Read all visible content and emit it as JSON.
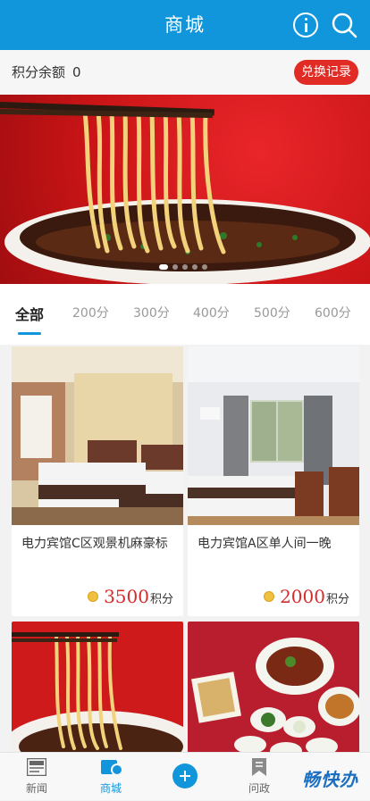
{
  "header": {
    "title": "商城",
    "info_icon": "info-icon",
    "search_icon": "search-icon"
  },
  "points": {
    "label": "积分余额",
    "value": "0",
    "exchange_label": "兑换记录"
  },
  "banner": {
    "icon": "noodle-bowl-image",
    "dots": 5,
    "active_dot": 1
  },
  "tabs": [
    {
      "label": "全部",
      "active": true
    },
    {
      "label": "200分"
    },
    {
      "label": "300分"
    },
    {
      "label": "400分"
    },
    {
      "label": "500分"
    },
    {
      "label": "600分"
    }
  ],
  "products": [
    {
      "name": "电力宾馆C区观景机麻豪标",
      "price": "3500",
      "unit": "积分",
      "image": "hotel-room-image"
    },
    {
      "name": "电力宾馆A区单人间一晚",
      "price": "2000",
      "unit": "积分",
      "image": "hotel-room-image"
    },
    {
      "name": "",
      "price": "",
      "unit": "",
      "image": "noodle-image"
    },
    {
      "name": "",
      "price": "",
      "unit": "",
      "image": "food-platter-image"
    }
  ],
  "tabbar": {
    "news_label": "新闻",
    "mall_label": "商城",
    "politics_label": "问政",
    "brand": "畅快办"
  },
  "colors": {
    "primary": "#1296db",
    "accent_red": "#e12b25",
    "price_red": "#d62b2b"
  }
}
